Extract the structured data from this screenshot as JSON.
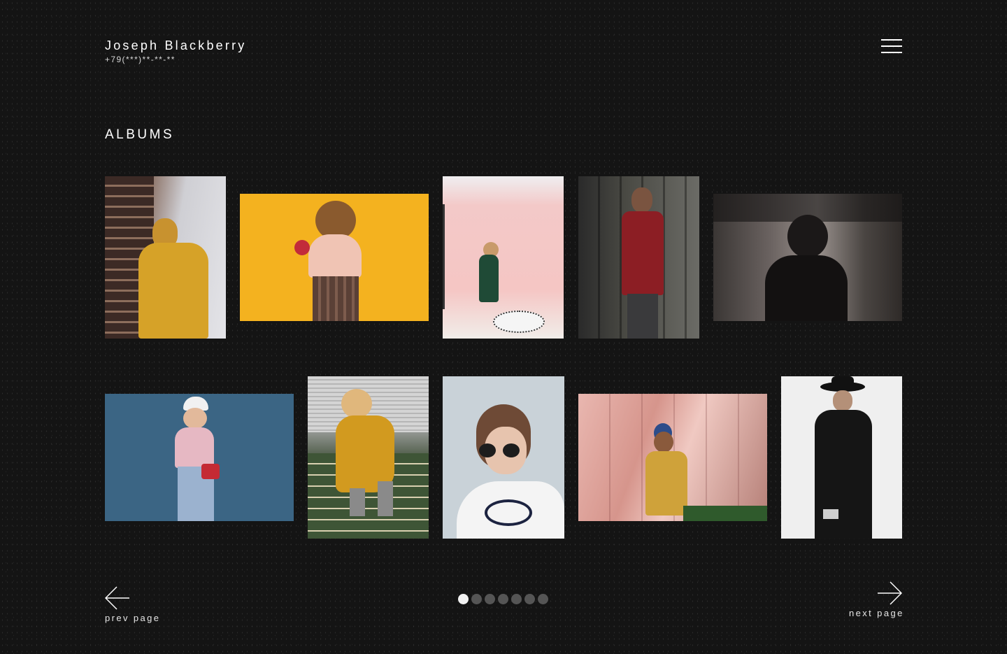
{
  "header": {
    "name": "Joseph Blackberry",
    "phone": "+79(***)**-**-**"
  },
  "menu": {
    "icon": "hamburger-menu-icon"
  },
  "section": {
    "title": "ALBUMS"
  },
  "albums": [
    {
      "name": "album-yellow-hoodie"
    },
    {
      "name": "album-yellow-backdrop"
    },
    {
      "name": "album-pink-studio"
    },
    {
      "name": "album-red-shirt"
    },
    {
      "name": "album-monochrome-portrait"
    },
    {
      "name": "album-blue-wall"
    },
    {
      "name": "album-yellow-dress-stairs"
    },
    {
      "name": "album-round-sunglasses"
    },
    {
      "name": "album-pink-building"
    },
    {
      "name": "album-black-hat"
    }
  ],
  "pagination": {
    "total_pages": 7,
    "current_page": 1,
    "prev_label": "prev page",
    "next_label": "next page"
  },
  "colors": {
    "background": "#141414",
    "text": "#ffffff",
    "dot_active": "#f2f2f2",
    "dot_inactive": "#555555"
  }
}
